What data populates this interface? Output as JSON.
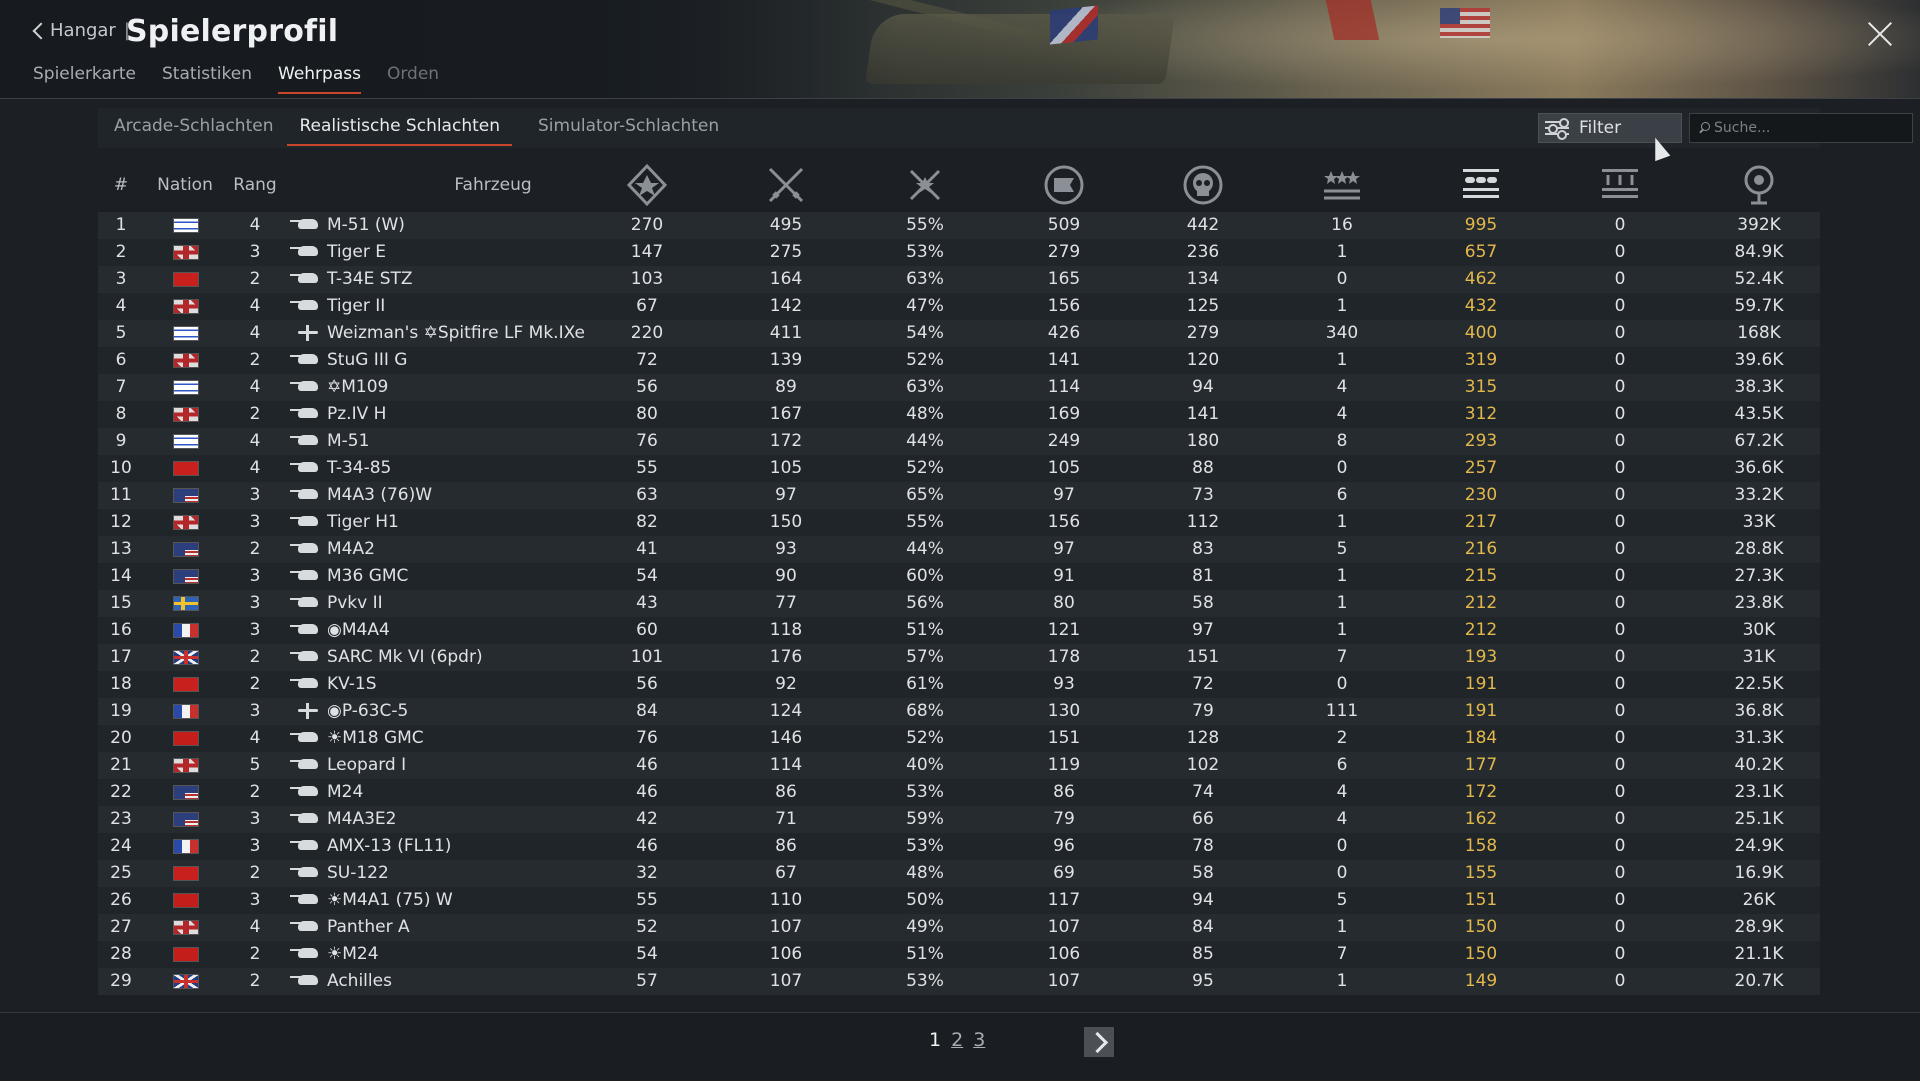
{
  "header": {
    "back_label": "Hangar",
    "back_separator": "|",
    "title": "Spielerprofil",
    "tabs": [
      {
        "label": "Spielerkarte",
        "state": "normal"
      },
      {
        "label": "Statistiken",
        "state": "normal"
      },
      {
        "label": "Wehrpass",
        "state": "active"
      },
      {
        "label": "Orden",
        "state": "dim"
      }
    ]
  },
  "modes": {
    "tabs": [
      {
        "label": "Arcade-Schlachten",
        "active": false
      },
      {
        "label": "Realistische Schlachten",
        "active": true
      },
      {
        "label": "Simulator-Schlachten",
        "active": false
      }
    ],
    "filter_label": "Filter",
    "search_placeholder": "Suche..."
  },
  "table": {
    "columns": {
      "num": "#",
      "nation": "Nation",
      "rank": "Rang",
      "vehicle": "Fahrzeug"
    },
    "stat_icons": [
      "battles-icon",
      "victories-icon",
      "win-rate-icon",
      "respawns-icon",
      "deaths-icon",
      "air-kills-icon",
      "ground-kills-icon",
      "naval-kills-icon",
      "experience-icon"
    ],
    "accent_color": "#e3b84b",
    "rows": [
      {
        "n": "1",
        "nation": "israel",
        "rank": "4",
        "type": "tank",
        "name": "M-51 (W)",
        "s": [
          "270",
          "495",
          "55%",
          "509",
          "442",
          "16",
          "995",
          "0",
          "392K"
        ]
      },
      {
        "n": "2",
        "nation": "germany",
        "rank": "3",
        "type": "tank",
        "name": "Tiger E",
        "s": [
          "147",
          "275",
          "53%",
          "279",
          "236",
          "1",
          "657",
          "0",
          "84.9K"
        ]
      },
      {
        "n": "3",
        "nation": "ussr",
        "rank": "2",
        "type": "tank",
        "name": "T-34E STZ",
        "s": [
          "103",
          "164",
          "63%",
          "165",
          "134",
          "0",
          "462",
          "0",
          "52.4K"
        ]
      },
      {
        "n": "4",
        "nation": "germany",
        "rank": "4",
        "type": "tank",
        "name": "Tiger II",
        "s": [
          "67",
          "142",
          "47%",
          "156",
          "125",
          "1",
          "432",
          "0",
          "59.7K"
        ]
      },
      {
        "n": "5",
        "nation": "israel",
        "rank": "4",
        "type": "plane",
        "name": "Weizman's ✡Spitfire LF Mk.IXe",
        "s": [
          "220",
          "411",
          "54%",
          "426",
          "279",
          "340",
          "400",
          "0",
          "168K"
        ]
      },
      {
        "n": "6",
        "nation": "germany",
        "rank": "2",
        "type": "tank",
        "name": "StuG III G",
        "s": [
          "72",
          "139",
          "52%",
          "141",
          "120",
          "1",
          "319",
          "0",
          "39.6K"
        ]
      },
      {
        "n": "7",
        "nation": "israel",
        "rank": "4",
        "type": "tank",
        "name": "✡M109",
        "s": [
          "56",
          "89",
          "63%",
          "114",
          "94",
          "4",
          "315",
          "0",
          "38.3K"
        ]
      },
      {
        "n": "8",
        "nation": "germany",
        "rank": "2",
        "type": "tank",
        "name": "Pz.IV H",
        "s": [
          "80",
          "167",
          "48%",
          "169",
          "141",
          "4",
          "312",
          "0",
          "43.5K"
        ]
      },
      {
        "n": "9",
        "nation": "israel",
        "rank": "4",
        "type": "tank",
        "name": "M-51",
        "s": [
          "76",
          "172",
          "44%",
          "249",
          "180",
          "8",
          "293",
          "0",
          "67.2K"
        ]
      },
      {
        "n": "10",
        "nation": "ussr",
        "rank": "4",
        "type": "tank",
        "name": "T-34-85",
        "s": [
          "55",
          "105",
          "52%",
          "105",
          "88",
          "0",
          "257",
          "0",
          "36.6K"
        ]
      },
      {
        "n": "11",
        "nation": "usa",
        "rank": "3",
        "type": "tank",
        "name": "M4A3 (76)W",
        "s": [
          "63",
          "97",
          "65%",
          "97",
          "73",
          "6",
          "230",
          "0",
          "33.2K"
        ]
      },
      {
        "n": "12",
        "nation": "germany",
        "rank": "3",
        "type": "tank",
        "name": "Tiger H1",
        "s": [
          "82",
          "150",
          "55%",
          "156",
          "112",
          "1",
          "217",
          "0",
          "33K"
        ]
      },
      {
        "n": "13",
        "nation": "usa",
        "rank": "2",
        "type": "tank",
        "name": "M4A2",
        "s": [
          "41",
          "93",
          "44%",
          "97",
          "83",
          "5",
          "216",
          "0",
          "28.8K"
        ]
      },
      {
        "n": "14",
        "nation": "usa",
        "rank": "3",
        "type": "tank",
        "name": "M36 GMC",
        "s": [
          "54",
          "90",
          "60%",
          "91",
          "81",
          "1",
          "215",
          "0",
          "27.3K"
        ]
      },
      {
        "n": "15",
        "nation": "sweden",
        "rank": "3",
        "type": "tank",
        "name": "Pvkv II",
        "s": [
          "43",
          "77",
          "56%",
          "80",
          "58",
          "1",
          "212",
          "0",
          "23.8K"
        ]
      },
      {
        "n": "16",
        "nation": "france",
        "rank": "3",
        "type": "tank",
        "name": "◉M4A4",
        "s": [
          "60",
          "118",
          "51%",
          "121",
          "97",
          "1",
          "212",
          "0",
          "30K"
        ]
      },
      {
        "n": "17",
        "nation": "britain",
        "rank": "2",
        "type": "tank",
        "name": "SARC Mk VI (6pdr)",
        "s": [
          "101",
          "176",
          "57%",
          "178",
          "151",
          "7",
          "193",
          "0",
          "31K"
        ]
      },
      {
        "n": "18",
        "nation": "ussr",
        "rank": "2",
        "type": "tank",
        "name": "KV-1S",
        "s": [
          "56",
          "92",
          "61%",
          "93",
          "72",
          "0",
          "191",
          "0",
          "22.5K"
        ]
      },
      {
        "n": "19",
        "nation": "france",
        "rank": "3",
        "type": "plane",
        "name": "◉P-63C-5",
        "s": [
          "84",
          "124",
          "68%",
          "130",
          "79",
          "111",
          "191",
          "0",
          "36.8K"
        ]
      },
      {
        "n": "20",
        "nation": "china",
        "rank": "4",
        "type": "tank",
        "name": "☀M18 GMC",
        "s": [
          "76",
          "146",
          "52%",
          "151",
          "128",
          "2",
          "184",
          "0",
          "31.3K"
        ]
      },
      {
        "n": "21",
        "nation": "germany",
        "rank": "5",
        "type": "tank",
        "name": "Leopard I",
        "s": [
          "46",
          "114",
          "40%",
          "119",
          "102",
          "6",
          "177",
          "0",
          "40.2K"
        ]
      },
      {
        "n": "22",
        "nation": "usa",
        "rank": "2",
        "type": "tank",
        "name": "M24",
        "s": [
          "46",
          "86",
          "53%",
          "86",
          "74",
          "4",
          "172",
          "0",
          "23.1K"
        ]
      },
      {
        "n": "23",
        "nation": "usa",
        "rank": "3",
        "type": "tank",
        "name": "M4A3E2",
        "s": [
          "42",
          "71",
          "59%",
          "79",
          "66",
          "4",
          "162",
          "0",
          "25.1K"
        ]
      },
      {
        "n": "24",
        "nation": "france",
        "rank": "3",
        "type": "tank",
        "name": "AMX-13 (FL11)",
        "s": [
          "46",
          "86",
          "53%",
          "96",
          "78",
          "0",
          "158",
          "0",
          "24.9K"
        ]
      },
      {
        "n": "25",
        "nation": "ussr",
        "rank": "2",
        "type": "tank",
        "name": "SU-122",
        "s": [
          "32",
          "67",
          "48%",
          "69",
          "58",
          "0",
          "155",
          "0",
          "16.9K"
        ]
      },
      {
        "n": "26",
        "nation": "china",
        "rank": "3",
        "type": "tank",
        "name": "☀M4A1 (75) W",
        "s": [
          "55",
          "110",
          "50%",
          "117",
          "94",
          "5",
          "151",
          "0",
          "26K"
        ]
      },
      {
        "n": "27",
        "nation": "germany",
        "rank": "4",
        "type": "tank",
        "name": "Panther A",
        "s": [
          "52",
          "107",
          "49%",
          "107",
          "84",
          "1",
          "150",
          "0",
          "28.9K"
        ]
      },
      {
        "n": "28",
        "nation": "china",
        "rank": "2",
        "type": "tank",
        "name": "☀M24",
        "s": [
          "54",
          "106",
          "51%",
          "106",
          "85",
          "7",
          "150",
          "0",
          "21.1K"
        ]
      },
      {
        "n": "29",
        "nation": "britain",
        "rank": "2",
        "type": "tank",
        "name": "Achilles",
        "s": [
          "57",
          "107",
          "53%",
          "107",
          "95",
          "1",
          "149",
          "0",
          "20.7K"
        ]
      }
    ]
  },
  "pagination": {
    "pages": [
      "1",
      "2",
      "3"
    ],
    "current": "1"
  }
}
